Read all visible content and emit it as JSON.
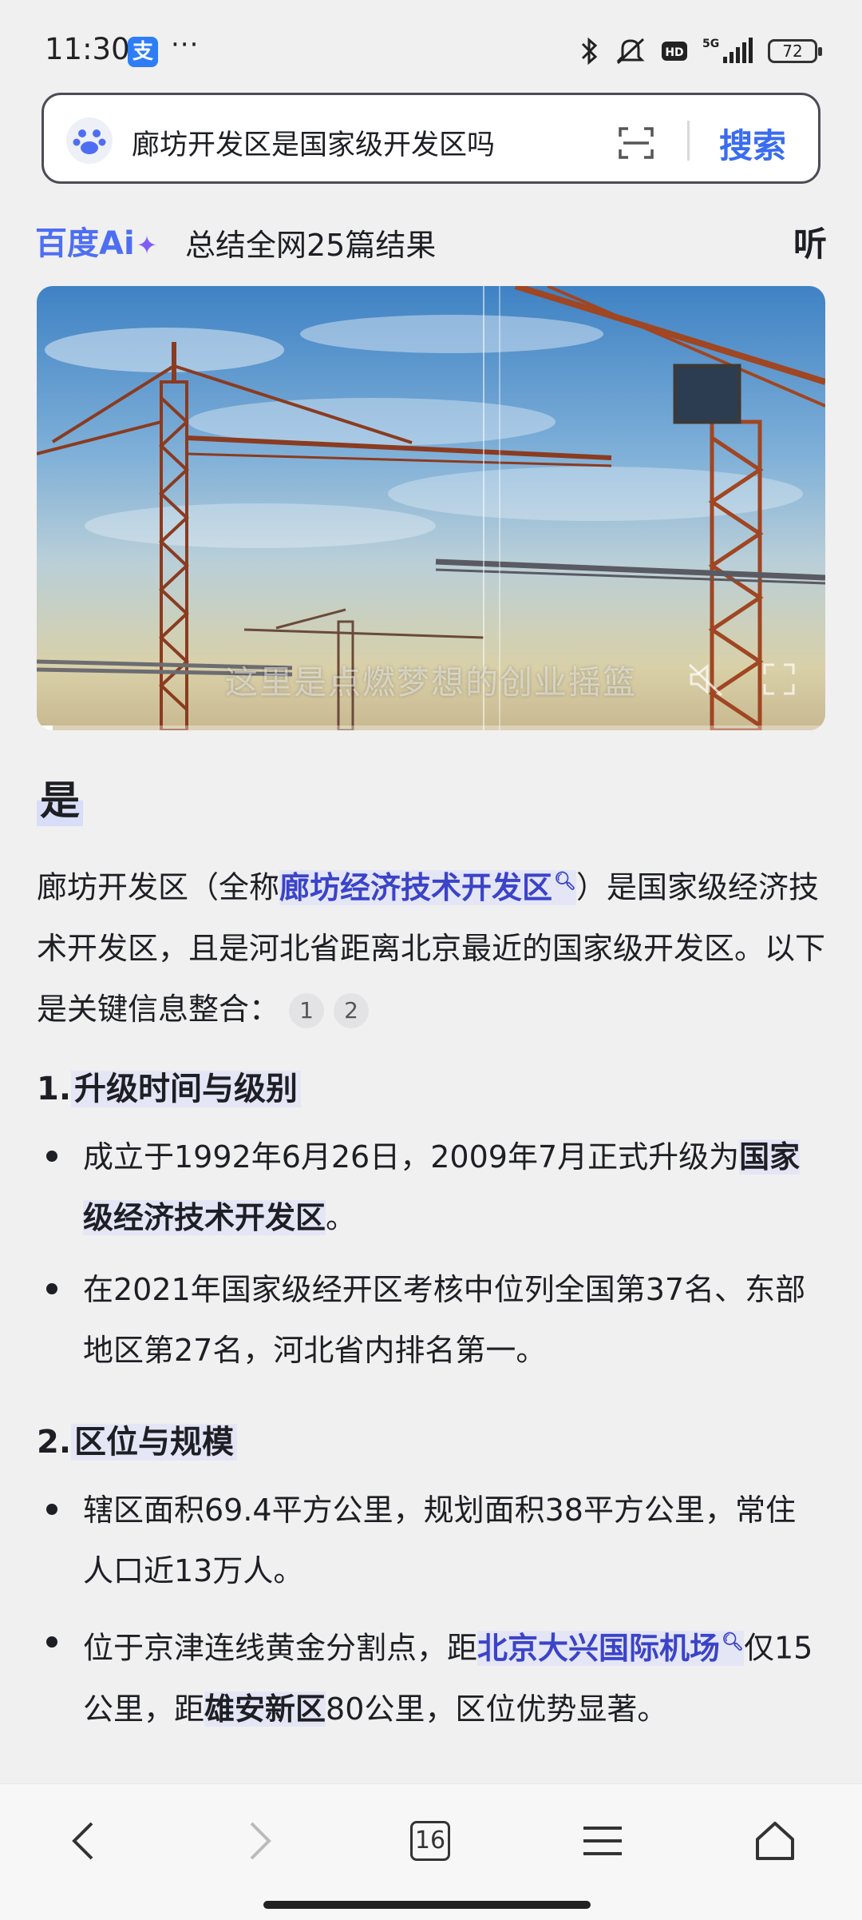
{
  "status_bar": {
    "time": "11:30",
    "app_badge": "支",
    "more": "···",
    "network": "5G",
    "battery": "72"
  },
  "search": {
    "query": "廊坊开发区是国家级开发区吗",
    "button": "搜索"
  },
  "ai_bar": {
    "logo": "百度Ai",
    "logo_plus": "✦",
    "summary": "总结全网25篇结果",
    "listen": "听"
  },
  "video": {
    "caption": "这里是点燃梦想的创业摇篮",
    "progress": 0.02
  },
  "answer": {
    "title": "是",
    "intro_1": "廊坊开发区（全称",
    "intro_link": "廊坊经济技术开发区",
    "intro_2": "）是国家级经济技术开发区，且是河北省距离北京最近的国家级开发区。以下是关键信息整合：",
    "cites": [
      "1",
      "2"
    ]
  },
  "sections": [
    {
      "num": "1.",
      "title": "升级时间与级别",
      "bullets": [
        {
          "t1": "成立于1992年6月26日，2009年7月正式升级为",
          "bold": "国家级经济技术开发区",
          "t2": "。"
        },
        {
          "t1": "在2021年国家级经开区考核中位列全国第37名、东部地区第27名，河北省内排名第一。"
        }
      ]
    },
    {
      "num": "2.",
      "title": "区位与规模",
      "bullets": [
        {
          "t1": "辖区面积69.4平方公里，规划面积38平方公里，常住人口近13万人。"
        },
        {
          "t1": "位于京津连线黄金分割点，距",
          "link": "北京大兴国际机场",
          "t2": "仅15公里，距",
          "bold": "雄安新区",
          "t3": "80公里，区位优势显著。"
        }
      ]
    }
  ],
  "bottom_nav": {
    "tab_count": "16"
  },
  "colors": {
    "accent": "#3a6cf0",
    "link": "#3b43c8",
    "ai_brand": "#4e6ef2",
    "highlight": "#e4e6f6"
  }
}
